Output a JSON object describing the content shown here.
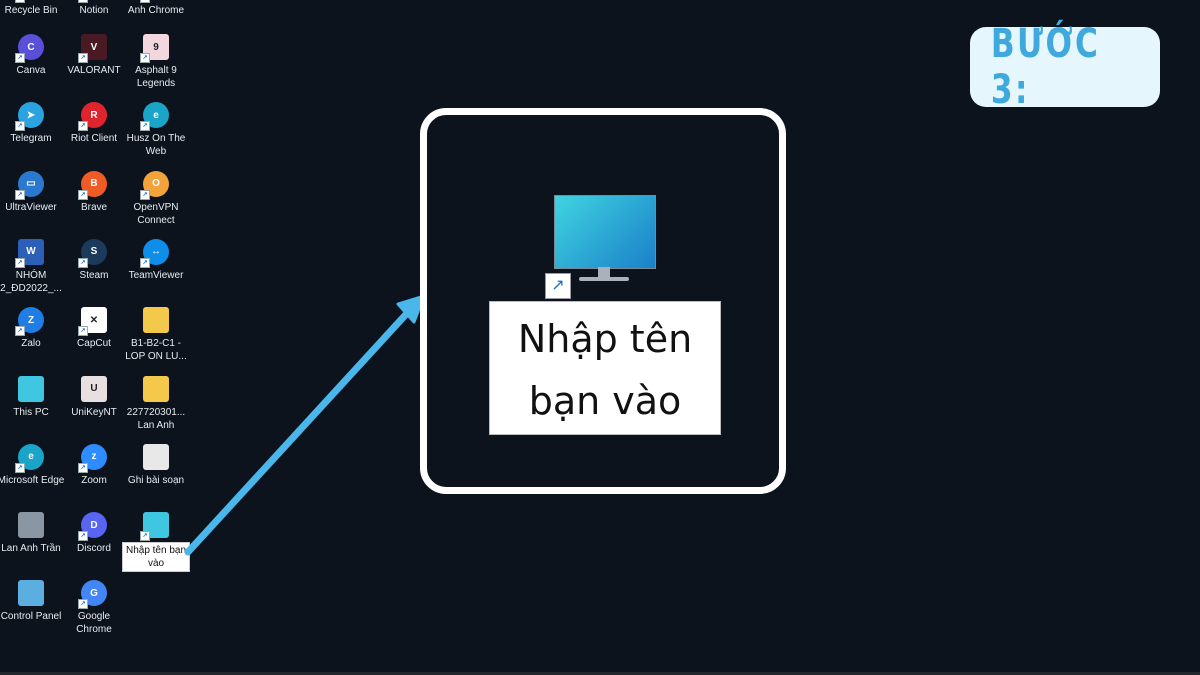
{
  "step_badge": {
    "text": "BƯỚC 3:"
  },
  "highlight": {
    "label": "Nhập tên bạn vào",
    "icon": "monitor-icon",
    "shortcut_icon": "shortcut-arrow-icon"
  },
  "colors": {
    "background": "#0c131d",
    "accent": "#4ab6ea",
    "badge_bg": "#e6f6fd",
    "badge_text": "#3fa9de"
  },
  "desktop": {
    "icons": [
      {
        "label": "Recycle Bin",
        "icon": "recycle-bin-icon",
        "color": "#6b7a8a",
        "col": 0,
        "row": -1
      },
      {
        "label": "Notion",
        "icon": "notion-icon",
        "color": "#ffffff",
        "col": 1,
        "row": -1
      },
      {
        "label": "Anh Chrome",
        "icon": "chrome-icon",
        "color": "#4285f4",
        "col": 2,
        "row": -1
      },
      {
        "label": "Canva",
        "icon": "canva-icon",
        "color": "#5a4fd8",
        "col": 0,
        "row": 0,
        "short": "C"
      },
      {
        "label": "VALORANT",
        "icon": "valorant-icon",
        "color": "#4a1a24",
        "col": 1,
        "row": 0,
        "short": "V"
      },
      {
        "label": "Asphalt 9 Legends",
        "icon": "asphalt-icon",
        "color": "#f2d7de",
        "col": 2,
        "row": 0,
        "short": "9"
      },
      {
        "label": "Telegram",
        "icon": "telegram-icon",
        "color": "#2aa3e0",
        "col": 0,
        "row": 1,
        "short": "➤"
      },
      {
        "label": "Riot Client",
        "icon": "riot-client-icon",
        "color": "#e0242e",
        "col": 1,
        "row": 1,
        "short": "R"
      },
      {
        "label": "Husz On The Web",
        "icon": "edge-icon",
        "color": "#1aa4c8",
        "col": 2,
        "row": 1,
        "short": "e"
      },
      {
        "label": "UltraViewer",
        "icon": "ultraviewer-icon",
        "color": "#2b78d0",
        "col": 0,
        "row": 2,
        "short": "▭"
      },
      {
        "label": "Brave",
        "icon": "brave-icon",
        "color": "#f05a24",
        "col": 1,
        "row": 2,
        "short": "B"
      },
      {
        "label": "OpenVPN Connect",
        "icon": "openvpn-icon",
        "color": "#f2a33a",
        "col": 2,
        "row": 2,
        "short": "O"
      },
      {
        "label": "NHÓM 2_ĐD2022_...",
        "icon": "word-document-icon",
        "color": "#2b5fb8",
        "col": 0,
        "row": 3,
        "short": "W"
      },
      {
        "label": "Steam",
        "icon": "steam-icon",
        "color": "#1b3a5c",
        "col": 1,
        "row": 3,
        "short": "S"
      },
      {
        "label": "TeamViewer",
        "icon": "teamviewer-icon",
        "color": "#0e8ee9",
        "col": 2,
        "row": 3,
        "short": "↔"
      },
      {
        "label": "Zalo",
        "icon": "zalo-icon",
        "color": "#1e7ee6",
        "col": 0,
        "row": 4,
        "short": "Z"
      },
      {
        "label": "CapCut",
        "icon": "capcut-icon",
        "color": "#ffffff",
        "col": 1,
        "row": 4,
        "short": "✕"
      },
      {
        "label": "B1-B2-C1 - LOP ON LU...",
        "icon": "folder-icon",
        "color": "#f4c84a",
        "col": 2,
        "row": 4,
        "short": ""
      },
      {
        "label": "This PC",
        "icon": "this-pc-icon",
        "color": "#3fc6e0",
        "col": 0,
        "row": 5,
        "short": ""
      },
      {
        "label": "UniKeyNT",
        "icon": "unikey-icon",
        "color": "#e8e0e0",
        "col": 1,
        "row": 5,
        "short": "U"
      },
      {
        "label": "227720301... Lan Anh",
        "icon": "folder-icon",
        "color": "#f4c84a",
        "col": 2,
        "row": 5,
        "short": ""
      },
      {
        "label": "Microsoft Edge",
        "icon": "edge-icon",
        "color": "#1aa4c8",
        "col": 0,
        "row": 6,
        "short": "e"
      },
      {
        "label": "Zoom",
        "icon": "zoom-icon",
        "color": "#2d8cff",
        "col": 1,
        "row": 6,
        "short": "z"
      },
      {
        "label": "Ghi bài soạn",
        "icon": "text-file-icon",
        "color": "#e8e8e8",
        "col": 2,
        "row": 6,
        "short": ""
      },
      {
        "label": "Lan Anh Trần",
        "icon": "user-folder-icon",
        "color": "#8a96a4",
        "col": 0,
        "row": 7,
        "short": ""
      },
      {
        "label": "Discord",
        "icon": "discord-icon",
        "color": "#5865f2",
        "col": 1,
        "row": 7,
        "short": "D"
      },
      {
        "label": "Nhập tên bạn vào",
        "icon": "monitor-icon",
        "color": "#3fc6e0",
        "col": 2,
        "row": 7,
        "short": "",
        "selected": true
      },
      {
        "label": "Control Panel",
        "icon": "control-panel-icon",
        "color": "#5aaee0",
        "col": 0,
        "row": 8,
        "short": ""
      },
      {
        "label": "Google Chrome",
        "icon": "chrome-icon",
        "color": "#4285f4",
        "col": 1,
        "row": 8,
        "short": "G"
      }
    ]
  }
}
